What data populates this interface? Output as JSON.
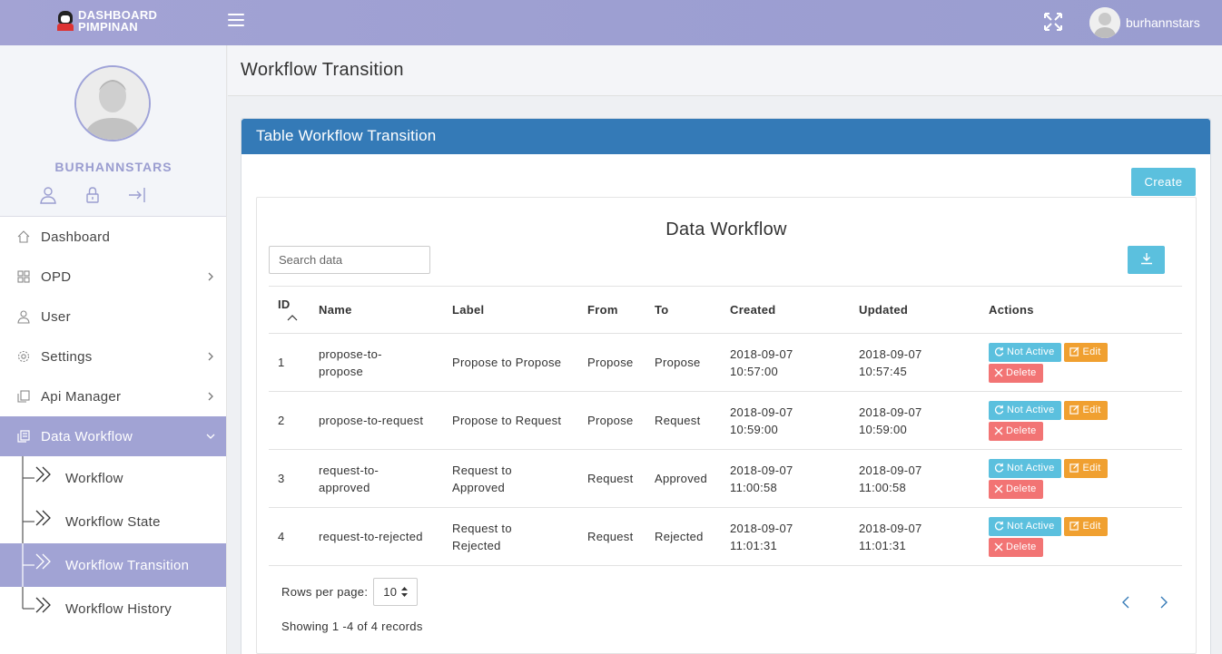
{
  "brand": {
    "line1": "DASHBOARD",
    "line2": "PIMPINAN"
  },
  "topbar": {
    "user_name": "burhannstars"
  },
  "profile": {
    "name": "BURHANNSTARS"
  },
  "menu": {
    "dashboard": "Dashboard",
    "opd": "OPD",
    "user": "User",
    "settings": "Settings",
    "api_manager": "Api Manager",
    "data_workflow": "Data Workflow",
    "sub": {
      "workflow": "Workflow",
      "workflow_state": "Workflow State",
      "workflow_transition": "Workflow Transition",
      "workflow_history": "Workflow History"
    }
  },
  "page": {
    "title": "Workflow Transition"
  },
  "card": {
    "header": "Table Workflow Transition",
    "create_label": "Create",
    "table_title": "Data Workflow",
    "search_placeholder": "Search data"
  },
  "table": {
    "headers": {
      "id": "ID",
      "name": "Name",
      "label": "Label",
      "from": "From",
      "to": "To",
      "created": "Created",
      "updated": "Updated",
      "actions": "Actions"
    },
    "action_labels": {
      "toggle": "Not Active",
      "edit": "Edit",
      "delete": "Delete"
    },
    "rows": [
      {
        "id": "1",
        "name": "propose-to-propose",
        "label": "Propose to Propose",
        "from": "Propose",
        "to": "Propose",
        "created": "2018-09-07 10:57:00",
        "updated": "2018-09-07 10:57:45"
      },
      {
        "id": "2",
        "name": "propose-to-request",
        "label": "Propose to Request",
        "from": "Propose",
        "to": "Request",
        "created": "2018-09-07 10:59:00",
        "updated": "2018-09-07 10:59:00"
      },
      {
        "id": "3",
        "name": "request-to-approved",
        "label": "Request to Approved",
        "from": "Request",
        "to": "Approved",
        "created": "2018-09-07 11:00:58",
        "updated": "2018-09-07 11:00:58"
      },
      {
        "id": "4",
        "name": "request-to-rejected",
        "label": "Request to Rejected",
        "from": "Request",
        "to": "Rejected",
        "created": "2018-09-07 11:01:31",
        "updated": "2018-09-07 11:01:31"
      }
    ]
  },
  "footer": {
    "rows_per_page_label": "Rows per page:",
    "rows_per_page_value": "10",
    "showing": "Showing 1 -4 of 4 records"
  },
  "colors": {
    "topbar": "#a3a3d4",
    "sidebar_active": "#a1a3d4",
    "card_header": "#347ab7",
    "info": "#5bc0de",
    "warning": "#f0a030",
    "danger": "#f27474"
  },
  "icons": [
    "hamburger-icon",
    "expand-icon",
    "user-icon",
    "lock-icon",
    "logout-icon",
    "home-icon",
    "grid-icon",
    "gear-icon",
    "file-icon",
    "building-icon",
    "chevron-right-icon",
    "chevron-down-icon",
    "double-chevron-icon",
    "download-icon",
    "refresh-icon",
    "edit-icon",
    "close-icon",
    "sort-caret-icon"
  ]
}
